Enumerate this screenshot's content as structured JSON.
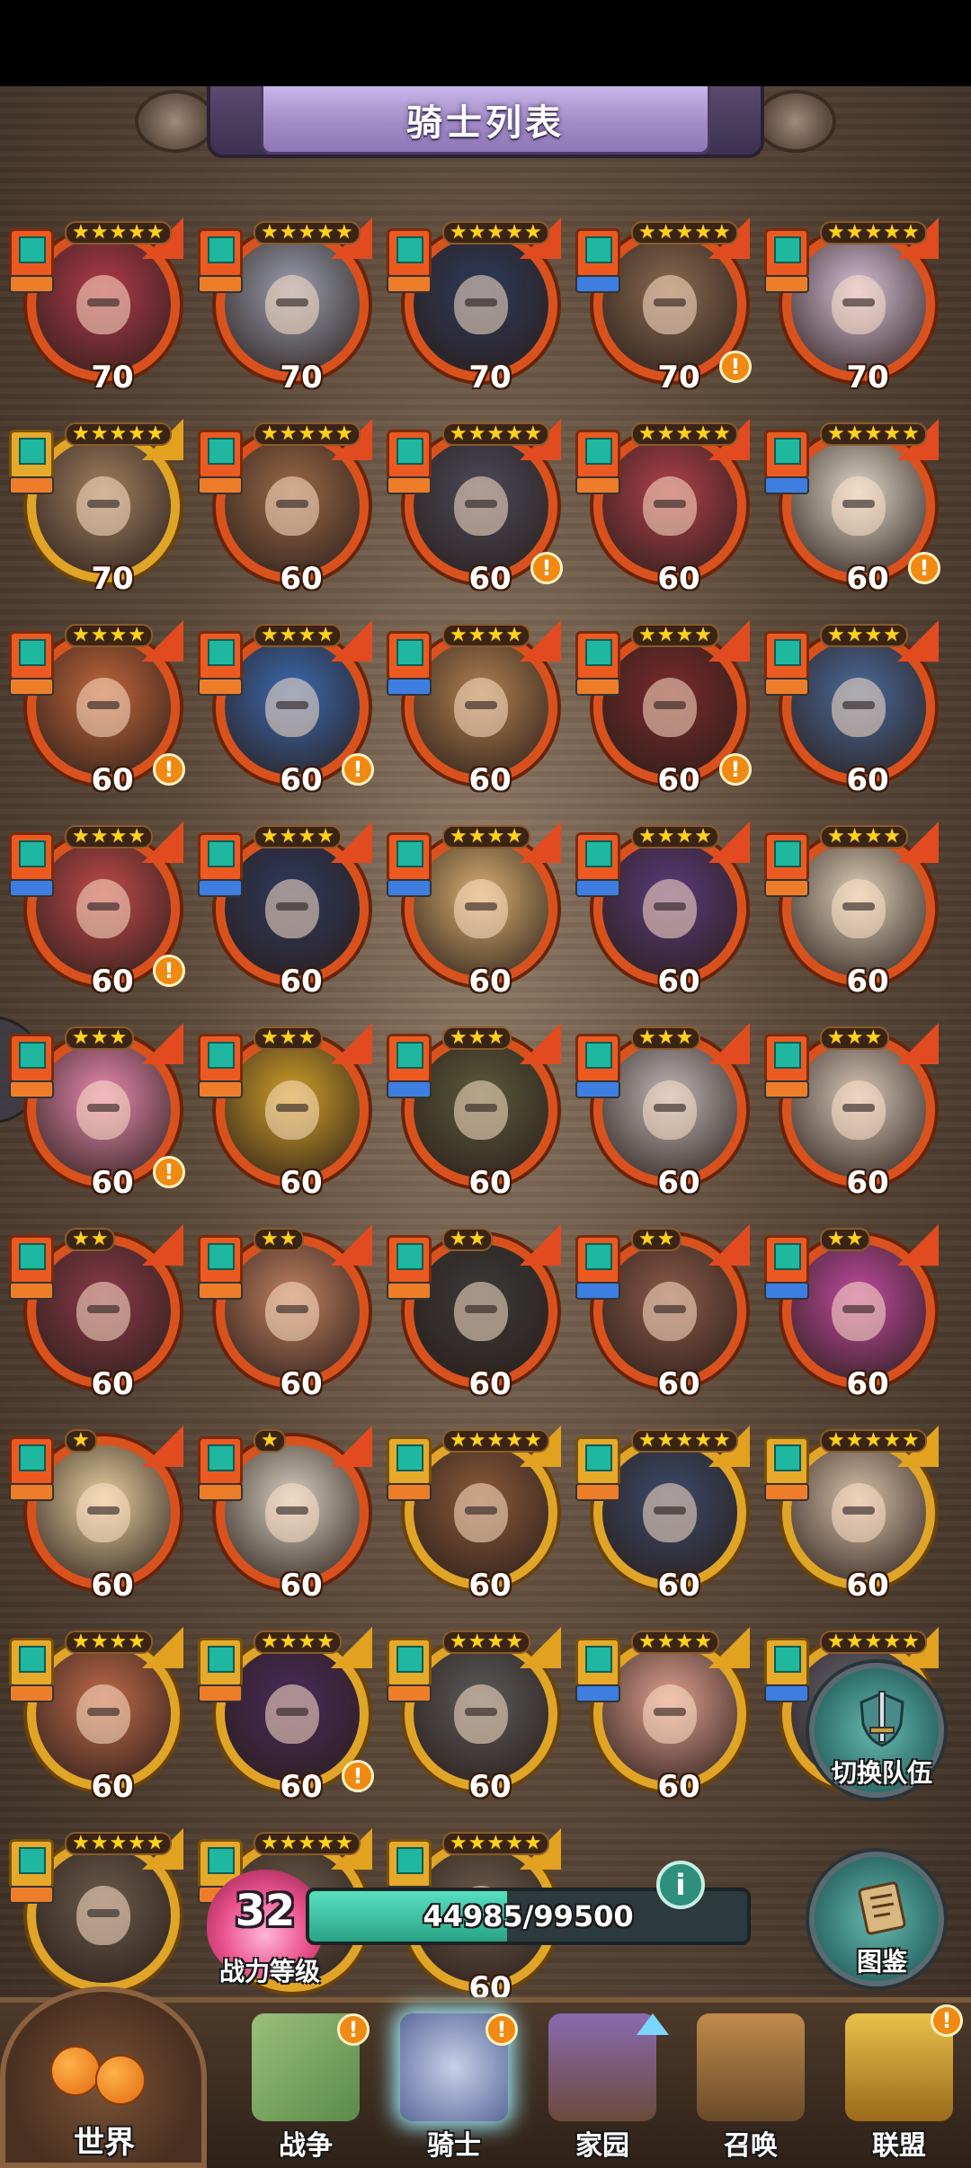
{
  "header": {
    "title": "骑士列表"
  },
  "colors": {
    "frame_orange": "#d9521d",
    "frame_gold": "#e0a527",
    "star": "#ffd21e",
    "alert": "#f08a12",
    "power_fill": "#58e0c0"
  },
  "knights": [
    {
      "level": "70",
      "stars": 5,
      "frame": "orange",
      "alert": false,
      "role": "orange",
      "portrait": "#b23a4a"
    },
    {
      "level": "70",
      "stars": 5,
      "frame": "orange",
      "alert": false,
      "role": "orange",
      "portrait": "#9aa0b0"
    },
    {
      "level": "70",
      "stars": 5,
      "frame": "orange",
      "alert": false,
      "role": "orange",
      "portrait": "#2d3a5a"
    },
    {
      "level": "70",
      "stars": 5,
      "frame": "orange",
      "alert": true,
      "role": "blue",
      "portrait": "#8a6a50"
    },
    {
      "level": "70",
      "stars": 5,
      "frame": "orange",
      "alert": false,
      "role": "orange",
      "portrait": "#d8c0d8"
    },
    {
      "level": "70",
      "stars": 5,
      "frame": "gold",
      "alert": false,
      "role": "orange",
      "portrait": "#a08060"
    },
    {
      "level": "60",
      "stars": 5,
      "frame": "orange",
      "alert": false,
      "role": "orange",
      "portrait": "#9a6a48"
    },
    {
      "level": "60",
      "stars": 5,
      "frame": "orange",
      "alert": true,
      "role": "orange",
      "portrait": "#4a4a5a"
    },
    {
      "level": "60",
      "stars": 5,
      "frame": "orange",
      "alert": false,
      "role": "orange",
      "portrait": "#b0404a"
    },
    {
      "level": "60",
      "stars": 5,
      "frame": "orange",
      "alert": true,
      "role": "blue",
      "portrait": "#e0d8c8"
    },
    {
      "level": "60",
      "stars": 4,
      "frame": "orange",
      "alert": true,
      "role": "orange",
      "portrait": "#c2663a"
    },
    {
      "level": "60",
      "stars": 4,
      "frame": "orange",
      "alert": true,
      "role": "orange",
      "portrait": "#3a6ab0"
    },
    {
      "level": "60",
      "stars": 4,
      "frame": "orange",
      "alert": false,
      "role": "blue",
      "portrait": "#b08050"
    },
    {
      "level": "60",
      "stars": 4,
      "frame": "orange",
      "alert": true,
      "role": "orange",
      "portrait": "#7a2a2a"
    },
    {
      "level": "60",
      "stars": 4,
      "frame": "orange",
      "alert": false,
      "role": "orange",
      "portrait": "#4a6a9a"
    },
    {
      "level": "60",
      "stars": 4,
      "frame": "orange",
      "alert": true,
      "role": "blue",
      "portrait": "#c04a4a"
    },
    {
      "level": "60",
      "stars": 4,
      "frame": "orange",
      "alert": false,
      "role": "blue",
      "portrait": "#2e3a5e"
    },
    {
      "level": "60",
      "stars": 4,
      "frame": "orange",
      "alert": false,
      "role": "blue",
      "portrait": "#d8b070"
    },
    {
      "level": "60",
      "stars": 4,
      "frame": "orange",
      "alert": false,
      "role": "blue",
      "portrait": "#5a3a7a"
    },
    {
      "level": "60",
      "stars": 4,
      "frame": "orange",
      "alert": false,
      "role": "orange",
      "portrait": "#e0d0b8"
    },
    {
      "level": "60",
      "stars": 3,
      "frame": "orange",
      "alert": true,
      "role": "orange",
      "portrait": "#e88ab0"
    },
    {
      "level": "60",
      "stars": 3,
      "frame": "orange",
      "alert": false,
      "role": "orange",
      "portrait": "#d0a028"
    },
    {
      "level": "60",
      "stars": 3,
      "frame": "orange",
      "alert": false,
      "role": "blue",
      "portrait": "#5a5a3a"
    },
    {
      "level": "60",
      "stars": 3,
      "frame": "orange",
      "alert": false,
      "role": "blue",
      "portrait": "#c0b8b8"
    },
    {
      "level": "60",
      "stars": 3,
      "frame": "orange",
      "alert": false,
      "role": "orange",
      "portrait": "#d8c8b8"
    },
    {
      "level": "60",
      "stars": 2,
      "frame": "orange",
      "alert": false,
      "role": "orange",
      "portrait": "#8a3a4a"
    },
    {
      "level": "60",
      "stars": 2,
      "frame": "orange",
      "alert": false,
      "role": "orange",
      "portrait": "#c08060"
    },
    {
      "level": "60",
      "stars": 2,
      "frame": "orange",
      "alert": false,
      "role": "orange",
      "portrait": "#3a3a3a"
    },
    {
      "level": "60",
      "stars": 2,
      "frame": "orange",
      "alert": false,
      "role": "blue",
      "portrait": "#8a5a48"
    },
    {
      "level": "60",
      "stars": 2,
      "frame": "orange",
      "alert": false,
      "role": "blue",
      "portrait": "#c04aa0"
    },
    {
      "level": "60",
      "stars": 1,
      "frame": "orange",
      "alert": false,
      "role": "orange",
      "portrait": "#e8d0a0"
    },
    {
      "level": "60",
      "stars": 1,
      "frame": "orange",
      "alert": false,
      "role": "orange",
      "portrait": "#d8d0c0"
    },
    {
      "level": "60",
      "stars": 5,
      "frame": "gold",
      "alert": false,
      "role": "orange",
      "portrait": "#8a5a3a"
    },
    {
      "level": "60",
      "stars": 5,
      "frame": "gold",
      "alert": false,
      "role": "orange",
      "portrait": "#3a4a6a"
    },
    {
      "level": "60",
      "stars": 5,
      "frame": "gold",
      "alert": false,
      "role": "orange",
      "portrait": "#d8c0a8"
    },
    {
      "level": "60",
      "stars": 4,
      "frame": "gold",
      "alert": false,
      "role": "orange",
      "portrait": "#c06a4a"
    },
    {
      "level": "60",
      "stars": 4,
      "frame": "gold",
      "alert": true,
      "role": "orange",
      "portrait": "#4a2a5a"
    },
    {
      "level": "60",
      "stars": 4,
      "frame": "gold",
      "alert": false,
      "role": "orange",
      "portrait": "#5a5a5a"
    },
    {
      "level": "60",
      "stars": 4,
      "frame": "gold",
      "alert": false,
      "role": "blue",
      "portrait": "#e0a090"
    },
    {
      "level": "",
      "stars": 5,
      "frame": "gold",
      "alert": false,
      "role": "blue",
      "portrait": "#6a6a7a"
    },
    {
      "level": "",
      "stars": 5,
      "frame": "gold",
      "alert": false,
      "role": "orange",
      "portrait": "#6a5a4a"
    },
    {
      "level": "",
      "stars": 5,
      "frame": "gold",
      "alert": false,
      "role": "orange",
      "portrait": "#6a5a4a"
    },
    {
      "level": "60",
      "stars": 5,
      "frame": "gold",
      "alert": false,
      "role": "orange",
      "portrait": "#6a5a4a"
    }
  ],
  "side_buttons": {
    "switch_team": "切换队伍",
    "codex": "图鉴"
  },
  "power": {
    "level": "32",
    "label": "战力等级",
    "current": "44985",
    "max": "99500",
    "fraction": 0.452
  },
  "nav": {
    "world": "世界",
    "items": [
      {
        "label": "战争",
        "alert": true
      },
      {
        "label": "骑士",
        "alert": true
      },
      {
        "label": "家园",
        "alert": false
      },
      {
        "label": "召唤",
        "alert": false
      },
      {
        "label": "联盟",
        "alert": true
      }
    ]
  }
}
